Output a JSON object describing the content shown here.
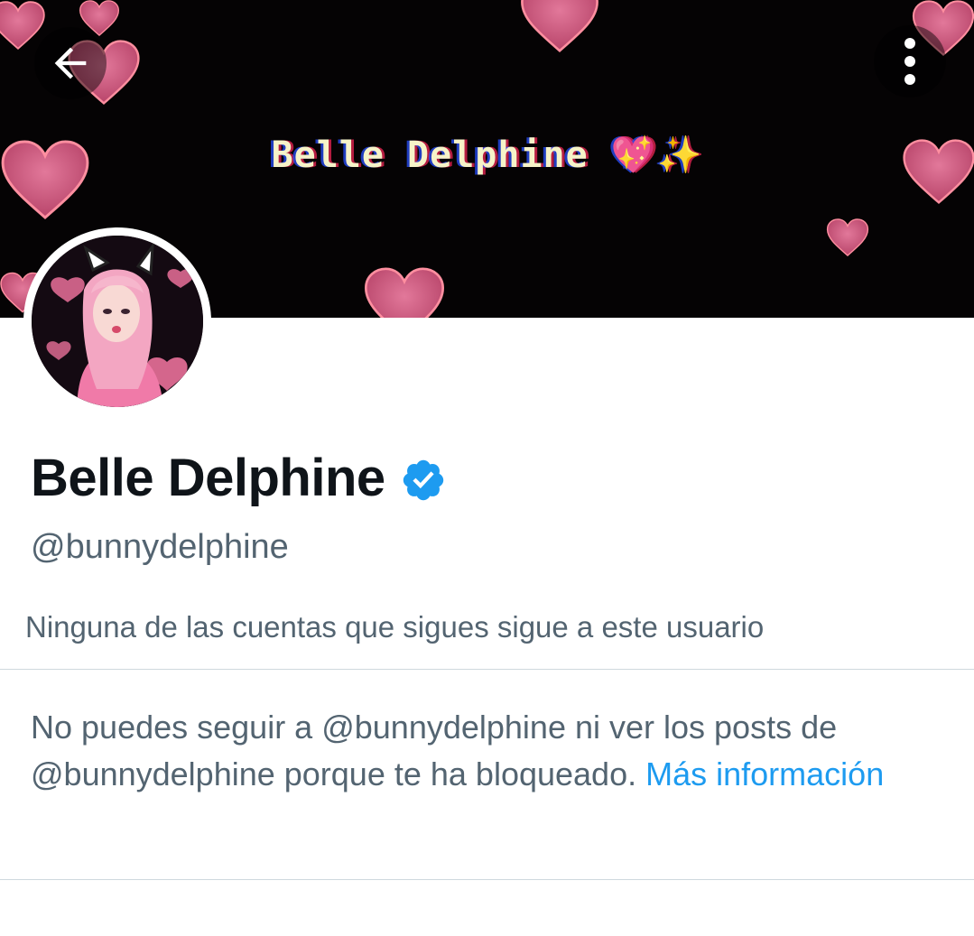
{
  "banner": {
    "title": "Belle Delphine",
    "title_emoji": "💖✨",
    "background_color": "#050304",
    "heart_color": "#d65a7e"
  },
  "nav": {
    "back_icon": "arrow-left-icon",
    "more_icon": "more-vertical-icon"
  },
  "profile": {
    "display_name": "Belle Delphine",
    "verified": true,
    "verified_icon": "verified-badge-icon",
    "handle": "@bunnydelphine",
    "follow_context": "Ninguna de las cuentas que sigues sigue a este usuario"
  },
  "blocked": {
    "message": "No puedes seguir a @bunnydelphine ni ver los posts de @bunnydelphine porque te ha bloqueado.",
    "link_label": "Más información"
  },
  "colors": {
    "text_primary": "#0f1419",
    "text_secondary": "#536471",
    "link": "#1d9bf0",
    "verified": "#1d9bf0",
    "divider": "#cfd9de"
  }
}
